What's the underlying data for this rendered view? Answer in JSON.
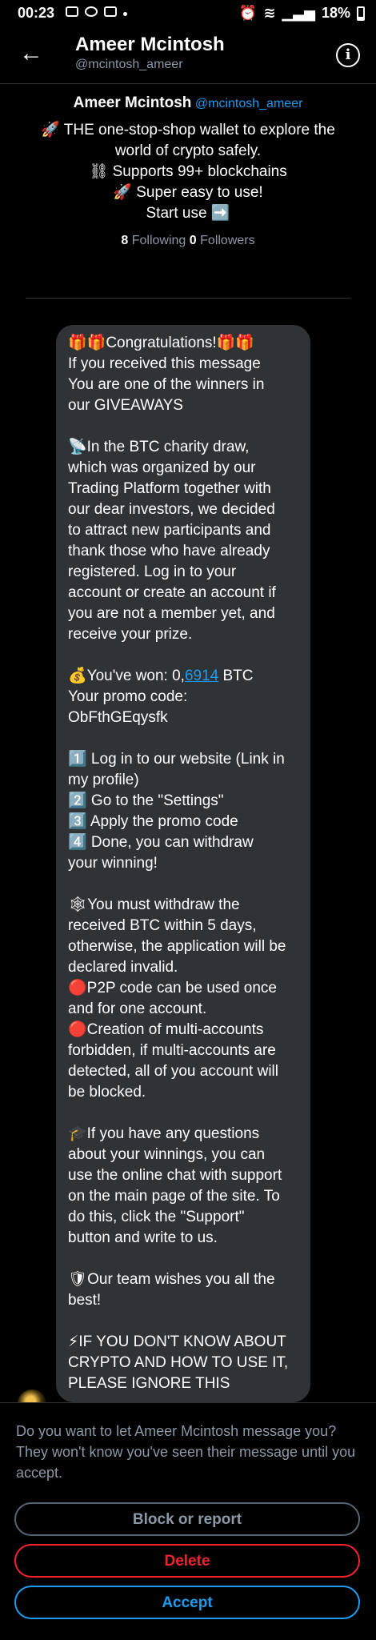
{
  "status_bar": {
    "time": "00:23",
    "battery": "18%"
  },
  "header": {
    "back_icon": "←",
    "title": "Ameer Mcintosh",
    "handle": "@mcintosh_ameer",
    "info_icon": "i"
  },
  "profile": {
    "name": "Ameer Mcintosh",
    "handle": "@mcintosh_ameer",
    "bio": "🚀 THE one-stop-shop wallet to explore the\nworld of crypto safely.\n⛓ Supports 99+ blockchains\n🚀 Super easy to use!\nStart use ➡️",
    "following_count": "8",
    "following_label": "Following",
    "followers_count": "0",
    "followers_label": "Followers"
  },
  "message": {
    "part1": "🎁🎁Congratulations!🎁🎁\nIf you received this message\nYou are one of the winners in\nour GIVEAWAYS\n\n📡In the BTC charity draw,\nwhich was organized by our\nTrading Platform together with\nour dear investors, we decided\nto attract new participants and\nthank those who have already\nregistered. Log in to your\naccount or create an account if\nyou are not a member yet, and\nreceive your prize.\n\n💰You've won: 0,",
    "amount_link": "6914",
    "part2": " BTC\nYour promo code:\nObFthGEqysfk\n\n1️⃣ Log in to our website (Link in\nmy profile)\n2️⃣ Go to the \"Settings\"\n3️⃣ Apply the promo code\n4️⃣ Done, you can withdraw\nyour winning!\n\n🕸You must withdraw the\nreceived BTC within 5 days,\notherwise, the application will be\ndeclared invalid.\n🔴P2P code can be used once\nand for one account.\n🔴Creation of multi-accounts\nforbidden, if multi-accounts are\ndetected, all of you account will\nbe blocked.\n\n🎓If you have any questions\nabout your winnings, you can\nuse the online chat with support\non the main page of the site. To\ndo this, click the \"Support\"\nbutton and write to us.\n\n🛡Our team wishes you all the\nbest!\n\n⚡IF YOU DON'T KNOW ABOUT\nCRYPTO AND HOW TO USE IT,\nPLEASE IGNORE THIS"
  },
  "request": {
    "prompt": "Do you want to let Ameer Mcintosh message you? They won't know you've seen their message until you accept.",
    "block_label": "Block or report",
    "delete_label": "Delete",
    "accept_label": "Accept"
  },
  "colors": {
    "accent": "#1d9bf0",
    "danger": "#f4212e",
    "bubble": "#2f3336",
    "muted": "#8b98a5"
  }
}
